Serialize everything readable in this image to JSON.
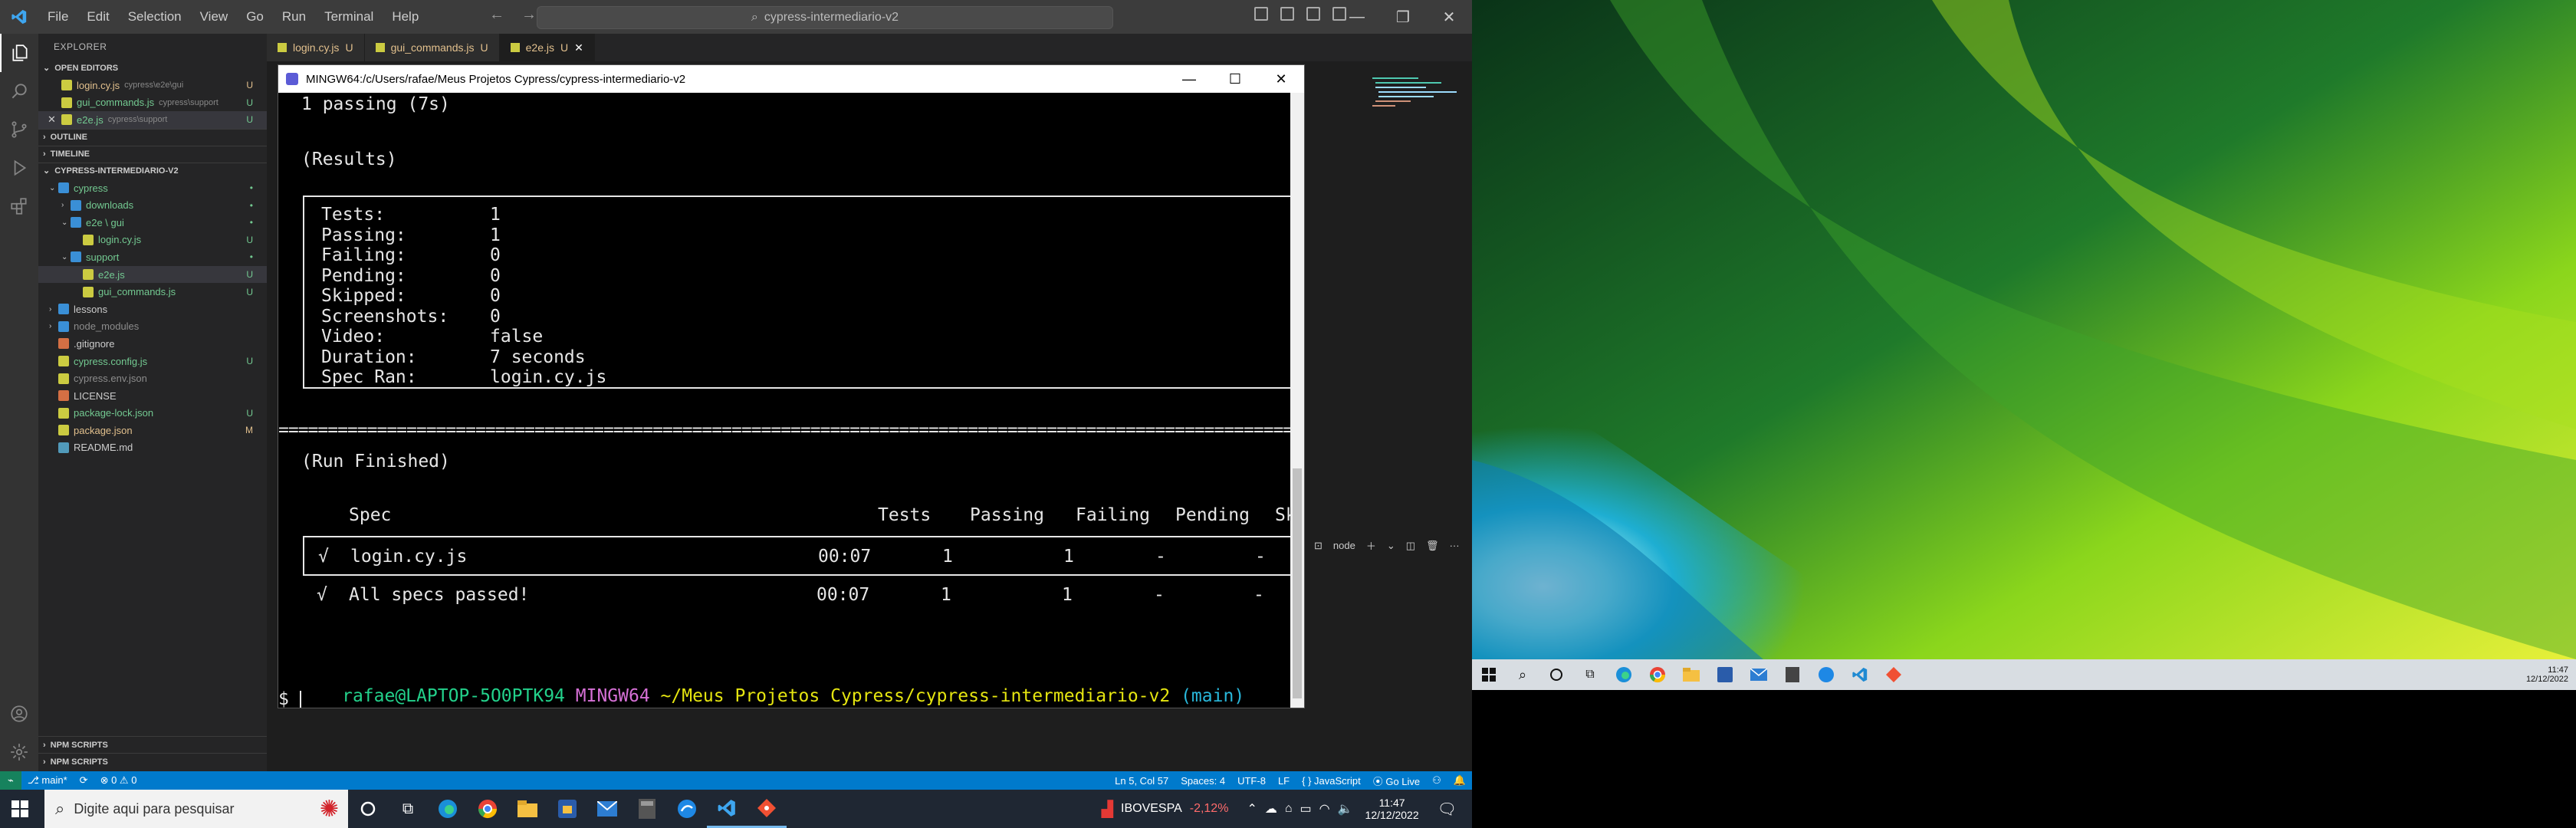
{
  "vscode": {
    "menu": [
      "File",
      "Edit",
      "Selection",
      "View",
      "Go",
      "Run",
      "Terminal",
      "Help"
    ],
    "command_center": "cypress-intermediario-v2",
    "explorer_title": "EXPLORER",
    "open_editors_header": "OPEN EDITORS",
    "open_editors": [
      {
        "name": "login.cy.js",
        "path": "cypress\\e2e\\gui",
        "badge": "U",
        "color": "#e2c08d"
      },
      {
        "name": "gui_commands.js",
        "path": "cypress\\support",
        "badge": "U",
        "color": "#73c991"
      },
      {
        "name": "e2e.js",
        "path": "cypress\\support",
        "badge": "U",
        "color": "#73c991"
      }
    ],
    "outline_header": "OUTLINE",
    "timeline_header": "TIMELINE",
    "project_header": "CYPRESS-INTERMEDIARIO-V2",
    "tree": [
      {
        "name": "cypress",
        "kind": "folder",
        "open": true,
        "indent": 0,
        "color": "#73c991",
        "badge": "•"
      },
      {
        "name": "downloads",
        "kind": "folder",
        "open": false,
        "indent": 1,
        "color": "#73c991",
        "badge": "•"
      },
      {
        "name": "e2e \\ gui",
        "kind": "folder",
        "open": true,
        "indent": 1,
        "color": "#73c991",
        "badge": "•"
      },
      {
        "name": "login.cy.js",
        "kind": "file",
        "indent": 2,
        "color": "#73c991",
        "badge": "U"
      },
      {
        "name": "support",
        "kind": "folder",
        "open": true,
        "indent": 1,
        "color": "#73c991",
        "badge": "•"
      },
      {
        "name": "e2e.js",
        "kind": "file",
        "indent": 2,
        "color": "#73c991",
        "badge": "U",
        "selected": true
      },
      {
        "name": "gui_commands.js",
        "kind": "file",
        "indent": 2,
        "color": "#73c991",
        "badge": "U"
      },
      {
        "name": "lessons",
        "kind": "folder",
        "open": false,
        "indent": 0,
        "color": "#cccccc",
        "badge": ""
      },
      {
        "name": "node_modules",
        "kind": "folder",
        "open": false,
        "indent": 0,
        "color": "#8c8c8c",
        "badge": ""
      },
      {
        "name": ".gitignore",
        "kind": "file",
        "indent": 0,
        "color": "#cccccc",
        "badge": ""
      },
      {
        "name": "cypress.config.js",
        "kind": "file",
        "indent": 0,
        "color": "#73c991",
        "badge": "U"
      },
      {
        "name": "cypress.env.json",
        "kind": "file",
        "indent": 0,
        "color": "#8c8c8c",
        "badge": ""
      },
      {
        "name": "LICENSE",
        "kind": "file",
        "indent": 0,
        "color": "#cccccc",
        "badge": ""
      },
      {
        "name": "package-lock.json",
        "kind": "file",
        "indent": 0,
        "color": "#73c991",
        "badge": "U"
      },
      {
        "name": "package.json",
        "kind": "file",
        "indent": 0,
        "color": "#e2c08d",
        "badge": "M"
      },
      {
        "name": "README.md",
        "kind": "file",
        "indent": 0,
        "color": "#cccccc",
        "badge": ""
      }
    ],
    "npm_scripts_1": "NPM SCRIPTS",
    "npm_scripts_2": "NPM SCRIPTS",
    "tabs": [
      {
        "name": "login.cy.js",
        "badge": "U"
      },
      {
        "name": "gui_commands.js",
        "badge": "U"
      },
      {
        "name": "e2e.js",
        "badge": "U",
        "active": true
      }
    ],
    "panel_node_label": "node",
    "status": {
      "branch": "main*",
      "errors": "⊗ 0 ⚠ 0",
      "ln_col": "Ln 5, Col 57",
      "spaces": "Spaces: 4",
      "encoding": "UTF-8",
      "eol": "LF",
      "lang": "{ } JavaScript",
      "golive": "Go Live"
    }
  },
  "terminal": {
    "window_title": "MINGW64:/c/Users/rafae/Meus Projetos Cypress/cypress-intermediario-v2",
    "passing_line": "1 passing (7s)",
    "results_heading": "(Results)",
    "results": [
      {
        "k": "Tests:",
        "v": "1"
      },
      {
        "k": "Passing:",
        "v": "1"
      },
      {
        "k": "Failing:",
        "v": "0"
      },
      {
        "k": "Pending:",
        "v": "0"
      },
      {
        "k": "Skipped:",
        "v": "0"
      },
      {
        "k": "Screenshots:",
        "v": "0"
      },
      {
        "k": "Video:",
        "v": "false"
      },
      {
        "k": "Duration:",
        "v": "7 seconds"
      },
      {
        "k": "Spec Ran:",
        "v": "login.cy.js"
      }
    ],
    "equals_line": "==========================================================================================================",
    "run_finished": "(Run Finished)",
    "table_headers": {
      "spec": "Spec",
      "tests": "Tests",
      "passing": "Passing",
      "failing": "Failing",
      "pending": "Pending",
      "skipped": "Ski"
    },
    "rows": [
      {
        "check": "√",
        "spec": "login.cy.js",
        "time": "00:07",
        "tests": "1",
        "passing": "1",
        "failing": "-",
        "pending": "-",
        "skipped": "-"
      },
      {
        "check": "√",
        "spec": "All specs passed!",
        "time": "00:07",
        "tests": "1",
        "passing": "1",
        "failing": "-",
        "pending": "-",
        "skipped": "-"
      }
    ],
    "prompt_user": "rafae@LAPTOP-5O0PTK94",
    "prompt_env": "MINGW64",
    "prompt_path": "~/Meus Projetos Cypress/cypress-intermediario-v2",
    "prompt_branch": "(main)",
    "prompt_symbol": "$"
  },
  "desktop": {
    "time": "11:47",
    "date": "12/12/2022"
  },
  "taskbar": {
    "search_placeholder": "Digite aqui para pesquisar",
    "ticker_name": "IBOVESPA",
    "ticker_value": "-2,12%",
    "time": "11:47",
    "date": "12/12/2022"
  }
}
